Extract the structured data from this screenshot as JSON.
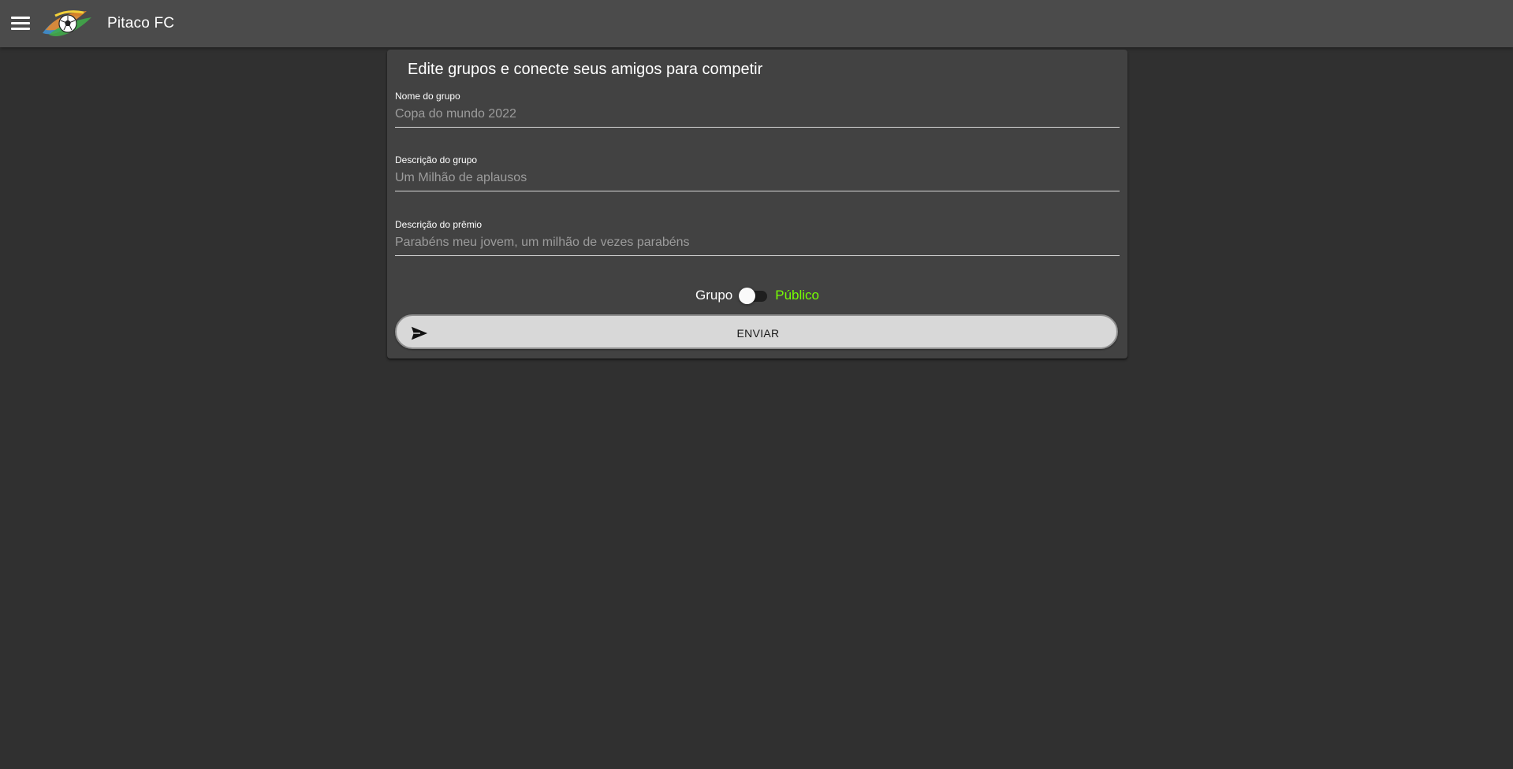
{
  "appbar": {
    "title": "Pitaco FC",
    "menu_icon": "hamburger-menu-icon",
    "logo_icon": "soccer-ball-logo"
  },
  "form": {
    "title": "Edite grupos e conecte seus amigos para competir",
    "fields": [
      {
        "label": "Nome do grupo",
        "value": "",
        "placeholder": "Copa do mundo 2022"
      },
      {
        "label": "Descrição do grupo",
        "value": "",
        "placeholder": "Um Milhão de aplausos"
      },
      {
        "label": "Descrição do prêmio",
        "value": "",
        "placeholder": "Parabéns meu jovem, um milhão de vezes parabéns"
      }
    ],
    "visibility": {
      "off_label": "Grupo",
      "on_label": "Público",
      "checked": false
    },
    "submit": {
      "label": "ENVIAR",
      "icon": "send-icon"
    }
  },
  "colors": {
    "background": "#303030",
    "appbar": "#4b4b4b",
    "card": "#424242",
    "accent_green": "#76ff03",
    "button": "#d8d8d8"
  }
}
